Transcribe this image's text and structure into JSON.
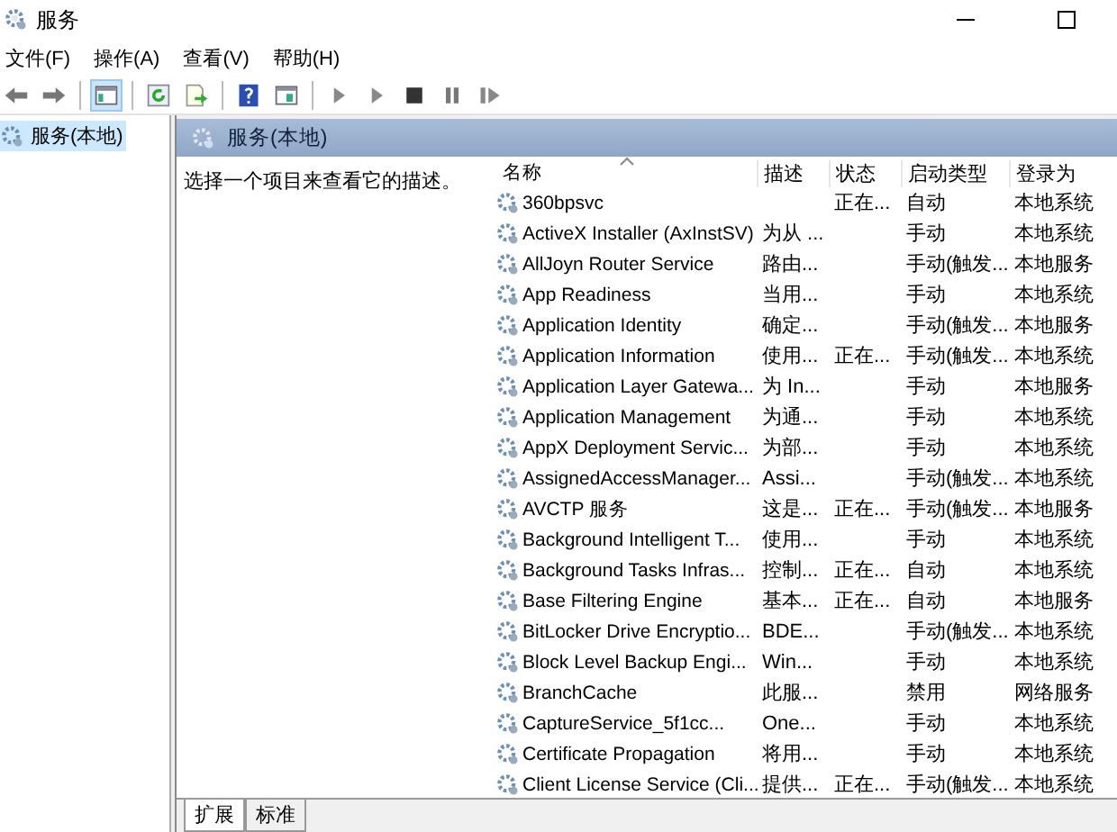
{
  "window": {
    "title": "服务"
  },
  "menu": [
    "文件(F)",
    "操作(A)",
    "查看(V)",
    "帮助(H)"
  ],
  "toolbar": [
    {
      "kind": "back",
      "disabled": false
    },
    {
      "kind": "forward",
      "disabled": false
    },
    {
      "kind": "sep"
    },
    {
      "kind": "tree",
      "selected": true
    },
    {
      "kind": "sep"
    },
    {
      "kind": "refresh",
      "disabled": false
    },
    {
      "kind": "export",
      "disabled": false
    },
    {
      "kind": "sep"
    },
    {
      "kind": "help",
      "disabled": false
    },
    {
      "kind": "props",
      "disabled": false
    },
    {
      "kind": "sep"
    },
    {
      "kind": "play",
      "disabled": false
    },
    {
      "kind": "play",
      "disabled": false
    },
    {
      "kind": "stop",
      "disabled": false
    },
    {
      "kind": "pause",
      "disabled": false
    },
    {
      "kind": "resume",
      "disabled": false
    }
  ],
  "tree": [
    {
      "label": "服务(本地)",
      "selected": true
    }
  ],
  "panel": {
    "title": "服务(本地)",
    "description": "选择一个项目来查看它的描述。"
  },
  "table": {
    "columns": [
      {
        "label": "名称",
        "sorted": true
      },
      {
        "label": "描述",
        "sorted": false
      },
      {
        "label": "状态",
        "sorted": false
      },
      {
        "label": "启动类型",
        "sorted": false
      },
      {
        "label": "登录为",
        "sorted": false
      }
    ],
    "rows": [
      [
        "360bpsvc",
        "",
        "正在...",
        "自动",
        "本地系统"
      ],
      [
        "ActiveX Installer (AxInstSV)",
        "为从 ...",
        "",
        "手动",
        "本地系统"
      ],
      [
        "AllJoyn Router Service",
        "路由...",
        "",
        "手动(触发...",
        "本地服务"
      ],
      [
        "App Readiness",
        "当用...",
        "",
        "手动",
        "本地系统"
      ],
      [
        "Application Identity",
        "确定...",
        "",
        "手动(触发...",
        "本地服务"
      ],
      [
        "Application Information",
        "使用...",
        "正在...",
        "手动(触发...",
        "本地系统"
      ],
      [
        "Application Layer Gatewa...",
        "为 In...",
        "",
        "手动",
        "本地服务"
      ],
      [
        "Application Management",
        "为通...",
        "",
        "手动",
        "本地系统"
      ],
      [
        "AppX Deployment Servic...",
        "为部...",
        "",
        "手动",
        "本地系统"
      ],
      [
        "AssignedAccessManager...",
        "Assi...",
        "",
        "手动(触发...",
        "本地系统"
      ],
      [
        "AVCTP 服务",
        "这是...",
        "正在...",
        "手动(触发...",
        "本地服务"
      ],
      [
        "Background Intelligent T...",
        "使用...",
        "",
        "手动",
        "本地系统"
      ],
      [
        "Background Tasks Infras...",
        "控制...",
        "正在...",
        "自动",
        "本地系统"
      ],
      [
        "Base Filtering Engine",
        "基本...",
        "正在...",
        "自动",
        "本地服务"
      ],
      [
        "BitLocker Drive Encryptio...",
        "BDE...",
        "",
        "手动(触发...",
        "本地系统"
      ],
      [
        "Block Level Backup Engi...",
        "Win...",
        "",
        "手动",
        "本地系统"
      ],
      [
        "BranchCache",
        "此服...",
        "",
        "禁用",
        "网络服务"
      ],
      [
        "CaptureService_5f1cc...",
        "One...",
        "",
        "手动",
        "本地系统"
      ],
      [
        "Certificate Propagation",
        "将用...",
        "",
        "手动",
        "本地系统"
      ],
      [
        "Client License Service (Cli...",
        "提供...",
        "正在...",
        "手动(触发...",
        "本地系统"
      ]
    ]
  },
  "bottom_tabs": [
    {
      "label": "扩展",
      "selected": true
    },
    {
      "label": "标准",
      "selected": false
    }
  ]
}
